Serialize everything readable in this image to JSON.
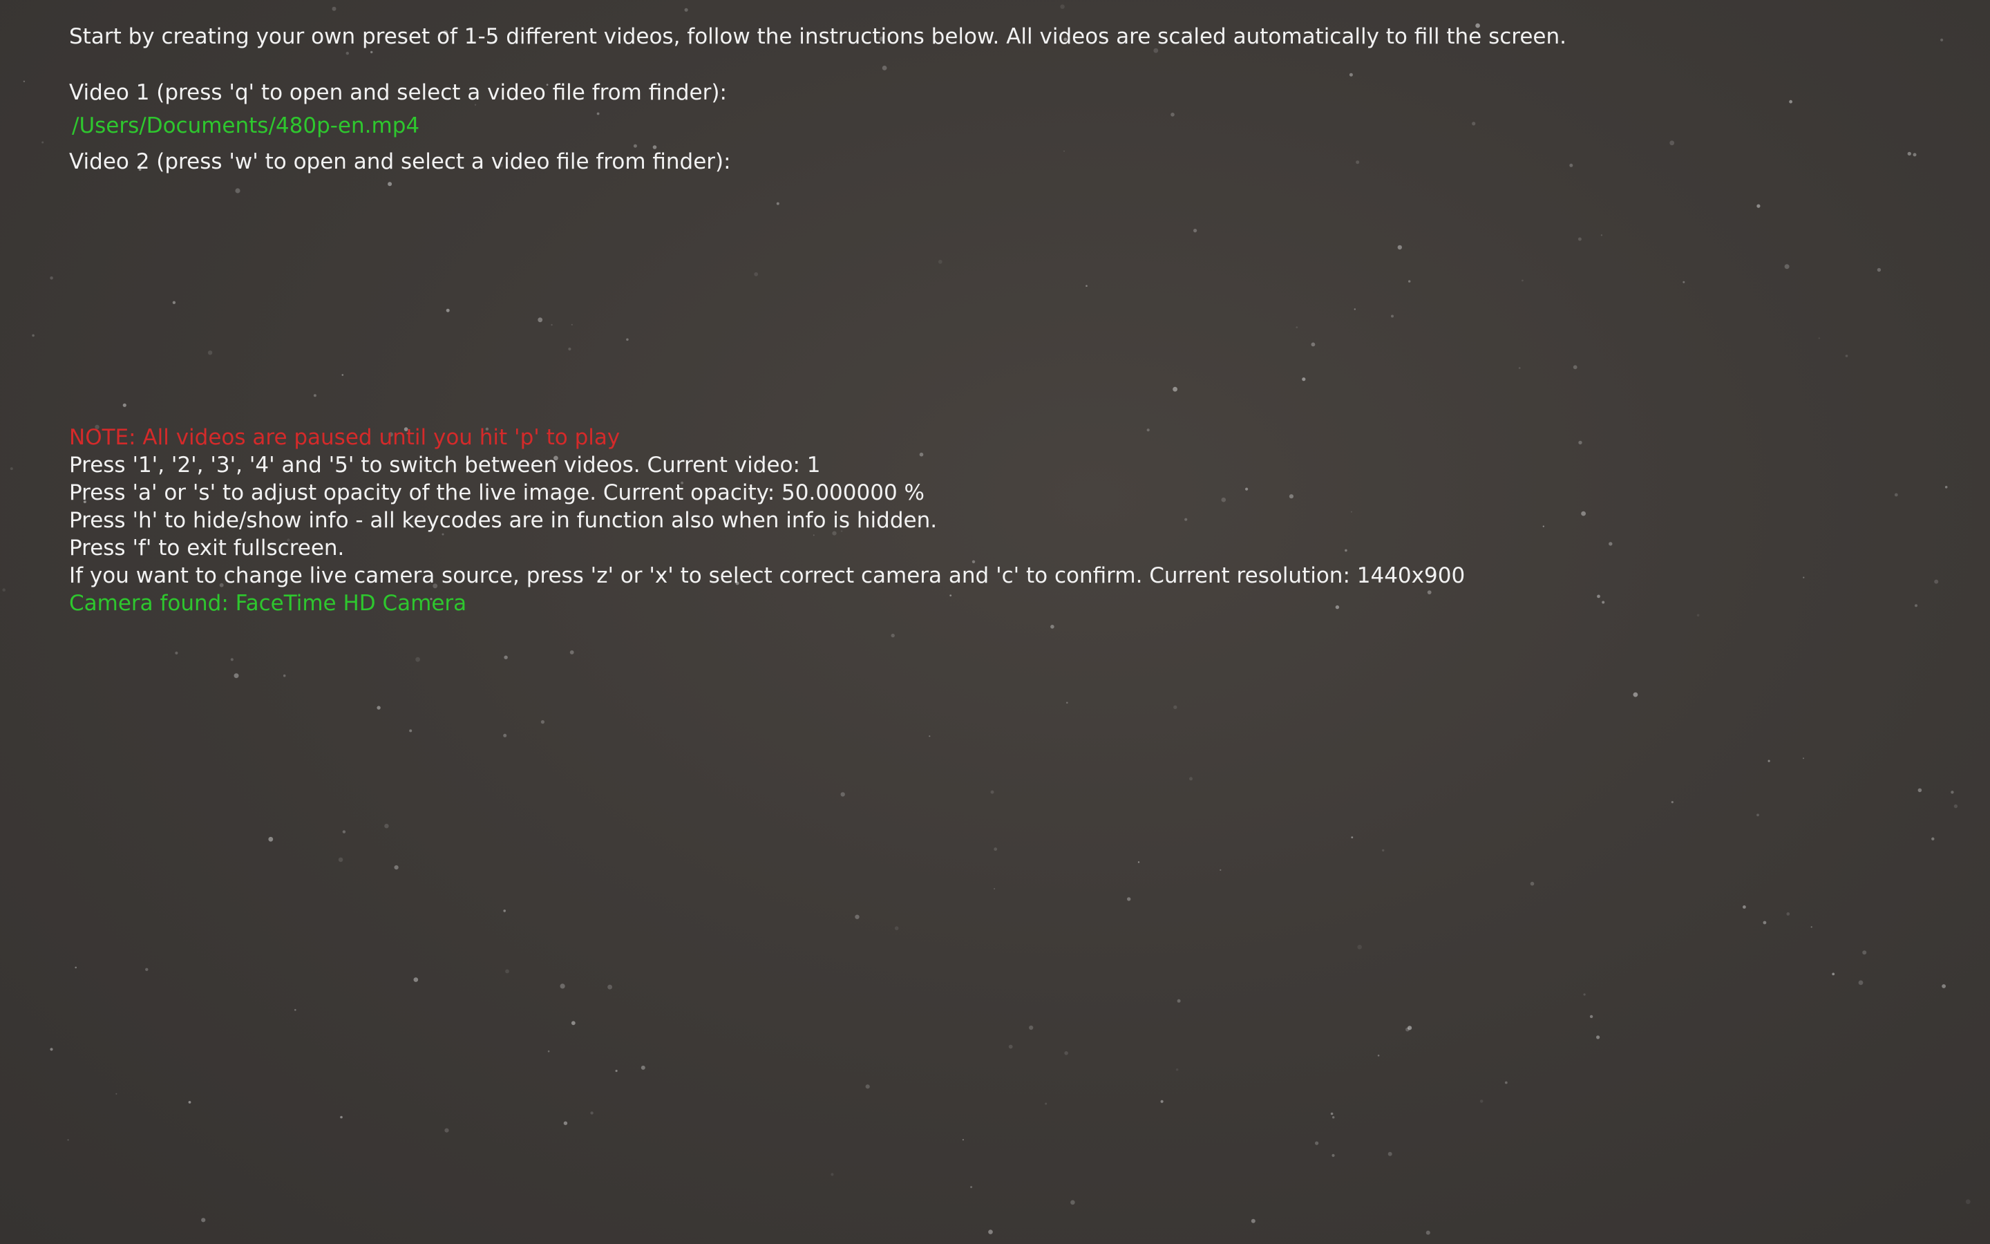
{
  "colors": {
    "text": "#f2f2f2",
    "path": "#2ec72e",
    "note": "#d42a2a",
    "background": "#3f3b38"
  },
  "intro": "Start by creating your own preset of 1-5 different videos, follow the instructions below. All videos are scaled automatically to fill the screen.",
  "videos": [
    {
      "prompt": "Video 1 (press 'q' to open and select a video file from finder):",
      "path": "/Users/Documents/480p-en.mp4"
    },
    {
      "prompt": "Video 2 (press 'w' to open and select a video file from finder):",
      "path": ""
    }
  ],
  "note": "NOTE: All videos are paused until you hit 'p' to play",
  "instructions": {
    "switch": "Press '1', '2', '3', '4' and '5' to switch between videos. Current video: 1",
    "opacity": "Press 'a' or 's' to adjust opacity of the live image. Current opacity: 50.000000 %",
    "info": "Press 'h' to hide/show info - all keycodes are in function also when info is hidden.",
    "fullscreen": "Press 'f' to exit fullscreen.",
    "camera": "If you want to change live camera source, press 'z' or 'x' to select correct camera and 'c' to confirm. Current resolution: 1440x900"
  },
  "camera_status": "Camera found: FaceTime HD Camera"
}
